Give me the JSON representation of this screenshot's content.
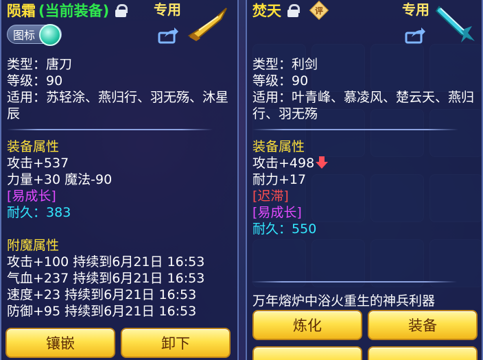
{
  "left": {
    "name": "陨霜",
    "equipped_tag": "(当前装备)",
    "special": "专用",
    "icon_toggle": "图标",
    "type_line": "类型：唐刀",
    "level_line": "等级：90",
    "use_line": "适用：苏轻涂、燕归行、羽无殇、沐星辰",
    "attr_title": "装备属性",
    "attack": "攻击+537",
    "stats2": "力量+30 魔法-90",
    "trait": "[易成长]",
    "durability_label": "耐久：",
    "durability_value": "383",
    "enchant_title": "附魔属性",
    "enchants": [
      "攻击+100 持续到6月21日 16:53",
      "气血+237 持续到6月21日 16:53",
      "速度+23 持续到6月21日 16:53",
      "防御+95 持续到6月21日 16:53"
    ],
    "btn_inlay": "镶嵌",
    "btn_unload": "卸下"
  },
  "right": {
    "name": "焚天",
    "rate_badge": "评",
    "special": "专用",
    "type_line": "类型：利剑",
    "level_line": "等级：90",
    "use_line": "适用：叶青峰、慕凌风、楚云天、燕归行、羽无殇",
    "attr_title": "装备属性",
    "attack": "攻击+498",
    "stamina": "耐力+17",
    "trait_red": "[迟滞]",
    "trait_magenta": "[易成长]",
    "durability_label": "耐久：",
    "durability_value": "550",
    "description": "万年熔炉中浴火重生的神兵利器",
    "btn_refine": "炼化",
    "btn_equip": "装备"
  },
  "colors": {
    "title": "#ffe23a",
    "equipped": "#2fe84d",
    "magenta": "#e24bff",
    "cyan": "#33e8ff",
    "red": "#ff4f4f",
    "button": "#ffe14a"
  },
  "icons": [
    "lock-icon",
    "rate-badge-icon",
    "share-icon",
    "weapon-blade-icon",
    "weapon-sword-icon",
    "attack-down-arrow-icon"
  ]
}
